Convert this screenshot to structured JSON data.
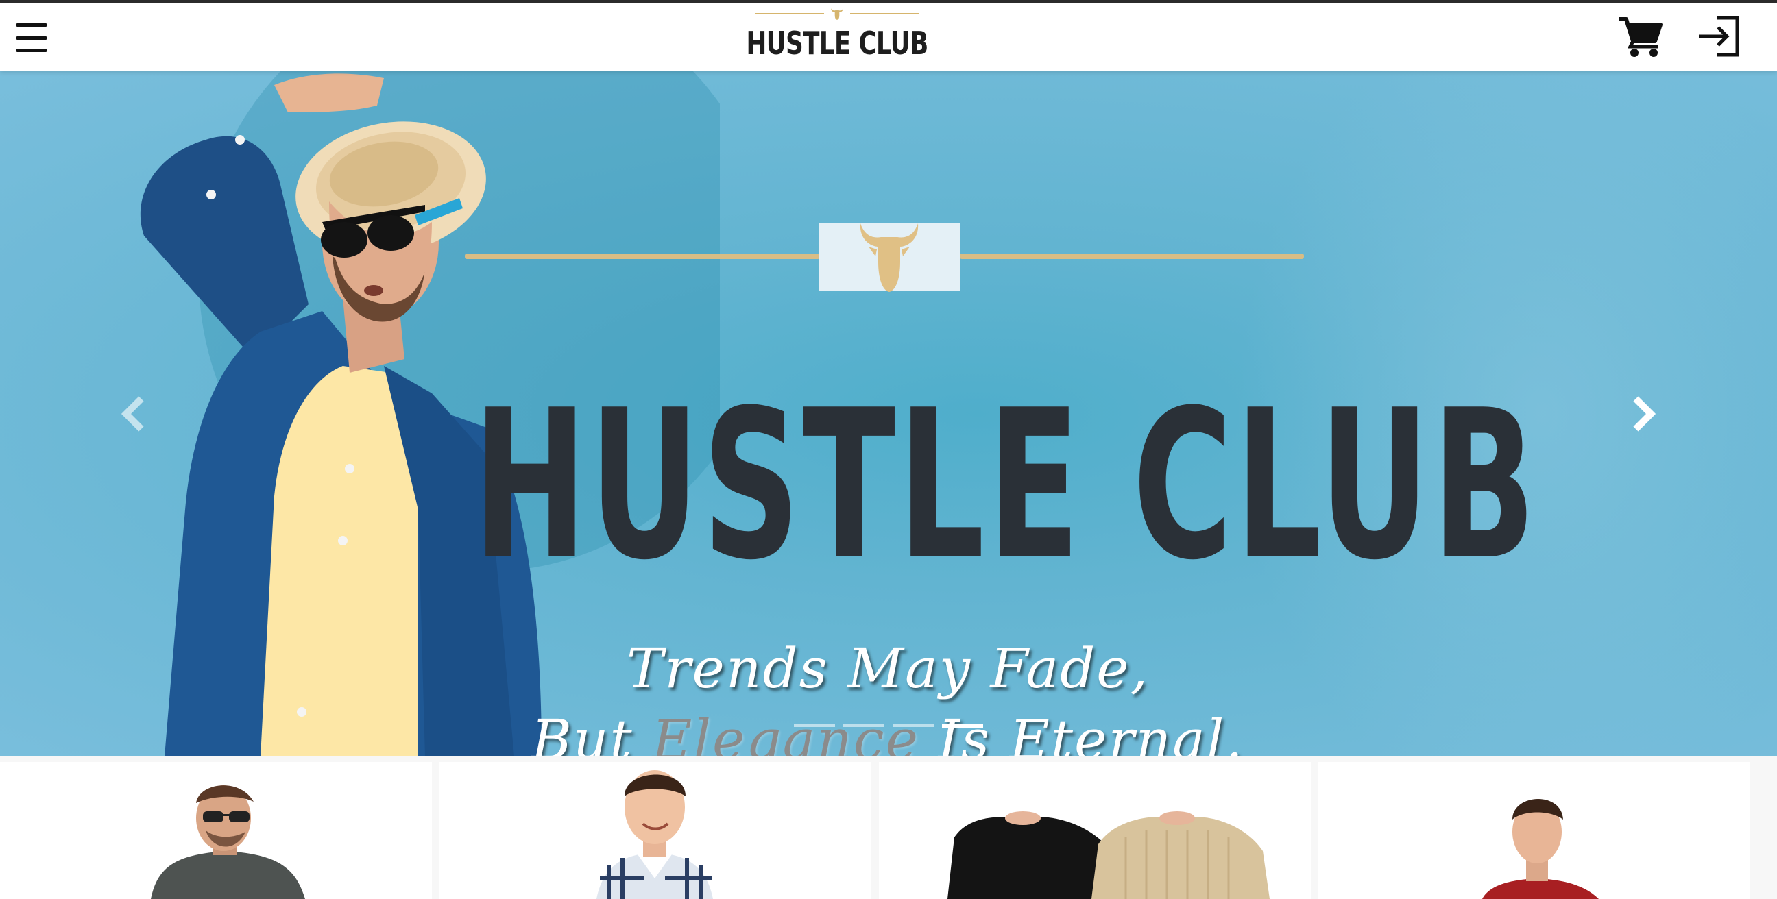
{
  "navbar": {
    "brand_name": "HUSTLE CLUB",
    "menu_icon": "hamburger-menu-icon",
    "cart_icon": "cart-icon",
    "login_icon": "login-icon",
    "colors": {
      "background": "#ffffff",
      "text": "#1e1e1e",
      "accent": "#d6b56d"
    }
  },
  "hero": {
    "title": "HUSTLE CLUB",
    "tagline_line1": "Trends May Fade,",
    "tagline_line2_before": "But ",
    "tagline_line2_accent": "Elegance",
    "tagline_line2_after": " Is Eternal.",
    "prev_icon": "chevron-left-icon",
    "next_icon": "chevron-right-icon",
    "emblem_icon": "bull-head-icon",
    "slide_count": 4,
    "active_slide": 4,
    "colors": {
      "background": "#62b4d1",
      "title": "#2a3037",
      "emblem": "#d8bd85",
      "tagline": "#ffffff"
    }
  },
  "products": {
    "items": [
      {
        "name": "product-card-1",
        "subject": "man in sunglasses, grey tee"
      },
      {
        "name": "product-card-2",
        "subject": "smiling man, checked shirt"
      },
      {
        "name": "product-card-3",
        "subject": "black and beige knit sweaters"
      },
      {
        "name": "product-card-4",
        "subject": "man in red tee"
      }
    ]
  }
}
